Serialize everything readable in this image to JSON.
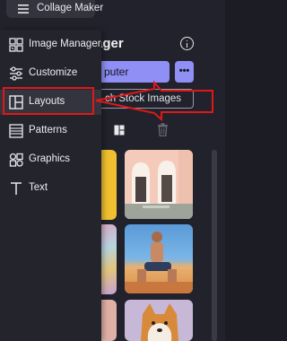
{
  "app": {
    "title": "Collage Maker",
    "menu_icon": "hamburger-icon"
  },
  "menu": {
    "items": [
      {
        "label": "Image Manager",
        "icon": "image-manager-icon",
        "active": false
      },
      {
        "label": "Customize",
        "icon": "sliders-icon",
        "active": false
      },
      {
        "label": "Layouts",
        "icon": "layout-icon",
        "active": true
      },
      {
        "label": "Patterns",
        "icon": "pattern-icon",
        "active": false
      },
      {
        "label": "Graphics",
        "icon": "shapes-icon",
        "active": false
      },
      {
        "label": "Text",
        "icon": "text-icon",
        "active": false
      }
    ]
  },
  "panel": {
    "title": "ager",
    "upload_label": "puter",
    "more_label": "•••",
    "stock_label": "ch Stock Images",
    "thumbnails": [
      "yellow-wall",
      "pink-building-doors",
      "marble-texture",
      "man-on-beach",
      "pink-texture",
      "shiba-dog"
    ]
  },
  "colors": {
    "accent": "#8f8ff5",
    "annotation": "#e01818",
    "menu_bg": "#24242d",
    "active_bg": "#34343f"
  }
}
